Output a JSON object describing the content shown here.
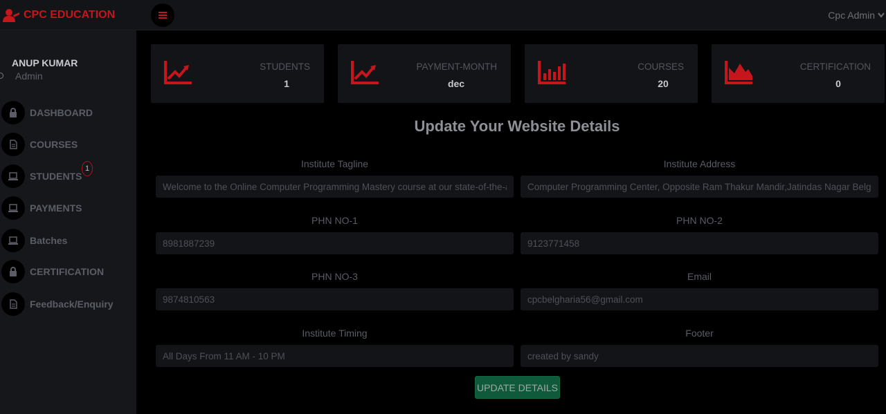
{
  "brand": {
    "name": "CPC EDUCATION",
    "icon": "user-graduate-icon",
    "color": "#c4161c"
  },
  "topbar": {
    "user_menu_label": "Cpc Admin"
  },
  "profile": {
    "name": "ANUP KUMAR",
    "role": "Admin"
  },
  "sidebar": {
    "items": [
      {
        "label": "DASHBOARD",
        "icon": "lock-icon"
      },
      {
        "label": "COURSES",
        "icon": "document-icon"
      },
      {
        "label": "STUDENTS",
        "icon": "laptop-icon",
        "badge": "1"
      },
      {
        "label": "PAYMENTS",
        "icon": "laptop-icon"
      },
      {
        "label": "Batches",
        "icon": "laptop-icon"
      },
      {
        "label": "CERTIFICATION",
        "icon": "lock-icon"
      },
      {
        "label": "Feedback/Enquiry",
        "icon": "document-icon"
      }
    ]
  },
  "cards": [
    {
      "label": "STUDENTS",
      "value": "1",
      "icon": "line-chart-icon"
    },
    {
      "label": "PAYMENT-MONTH",
      "value": "dec",
      "icon": "line-chart-icon"
    },
    {
      "label": "COURSES",
      "value": "20",
      "icon": "bar-chart-icon"
    },
    {
      "label": "CERTIFICATION",
      "value": "0",
      "icon": "area-chart-icon"
    }
  ],
  "accent_color": "#c4161c",
  "form": {
    "title": "Update Your Website Details",
    "fields": [
      {
        "label": "Institute Tagline",
        "value": "Welcome to the Online Computer Programming Mastery course at our state-of-the-art"
      },
      {
        "label": "Institute Address",
        "value": "Computer Programming Center, Opposite Ram Thakur Mandir,Jatindas Nagar Belgharia"
      },
      {
        "label": "PHN NO-1",
        "value": "8981887239"
      },
      {
        "label": "PHN NO-2",
        "value": "9123771458"
      },
      {
        "label": "PHN NO-3",
        "value": "9874810563"
      },
      {
        "label": "Email",
        "value": "cpcbelgharia56@gmail.com"
      },
      {
        "label": "Institute Timing",
        "value": "All Days From 11 AM - 10 PM"
      },
      {
        "label": "Footer",
        "value": "created by sandy"
      }
    ],
    "submit_label": "UPDATE DETAILS",
    "submit_color": "#0e5a3a"
  }
}
